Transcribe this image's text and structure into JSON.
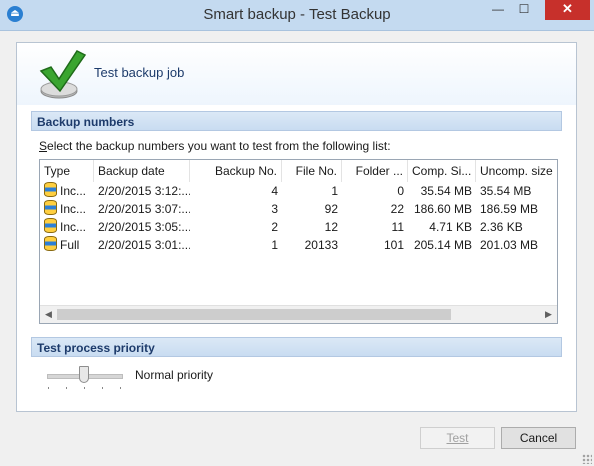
{
  "window": {
    "title": "Smart backup - Test Backup",
    "minimize_glyph": "—",
    "maximize_glyph": "☐",
    "close_glyph": "✕"
  },
  "header": {
    "title": "Test backup job",
    "icon": "checkmark-icon"
  },
  "backup_numbers": {
    "section_title": "Backup numbers",
    "instruction": "elect the backup numbers you want to test from the following list:",
    "instruction_accel": "S",
    "columns": [
      "Type",
      "Backup date",
      "Backup No.",
      "File No.",
      "Folder ...",
      "Comp. Si...",
      "Uncomp. size"
    ],
    "rows": [
      {
        "type": "Inc...",
        "date": "2/20/2015 3:12:...",
        "backup_no": "4",
        "file_no": "1",
        "folder_no": "0",
        "comp_size": "35.54 MB",
        "uncomp_size": "35.54 MB"
      },
      {
        "type": "Inc...",
        "date": "2/20/2015 3:07:...",
        "backup_no": "3",
        "file_no": "92",
        "folder_no": "22",
        "comp_size": "186.60 MB",
        "uncomp_size": "186.59 MB"
      },
      {
        "type": "Inc...",
        "date": "2/20/2015 3:05:...",
        "backup_no": "2",
        "file_no": "12",
        "folder_no": "11",
        "comp_size": "4.71 KB",
        "uncomp_size": "2.36 KB"
      },
      {
        "type": "Full",
        "date": "2/20/2015 3:01:...",
        "backup_no": "1",
        "file_no": "20133",
        "folder_no": "101",
        "comp_size": "205.14 MB",
        "uncomp_size": "201.03 MB"
      }
    ],
    "scroll_left": "◀",
    "scroll_right": "▶"
  },
  "priority": {
    "section_title": "Test process priority",
    "value_label": "Normal priority",
    "level_fraction": 0.5
  },
  "buttons": {
    "test": "Test",
    "cancel": "Cancel"
  }
}
